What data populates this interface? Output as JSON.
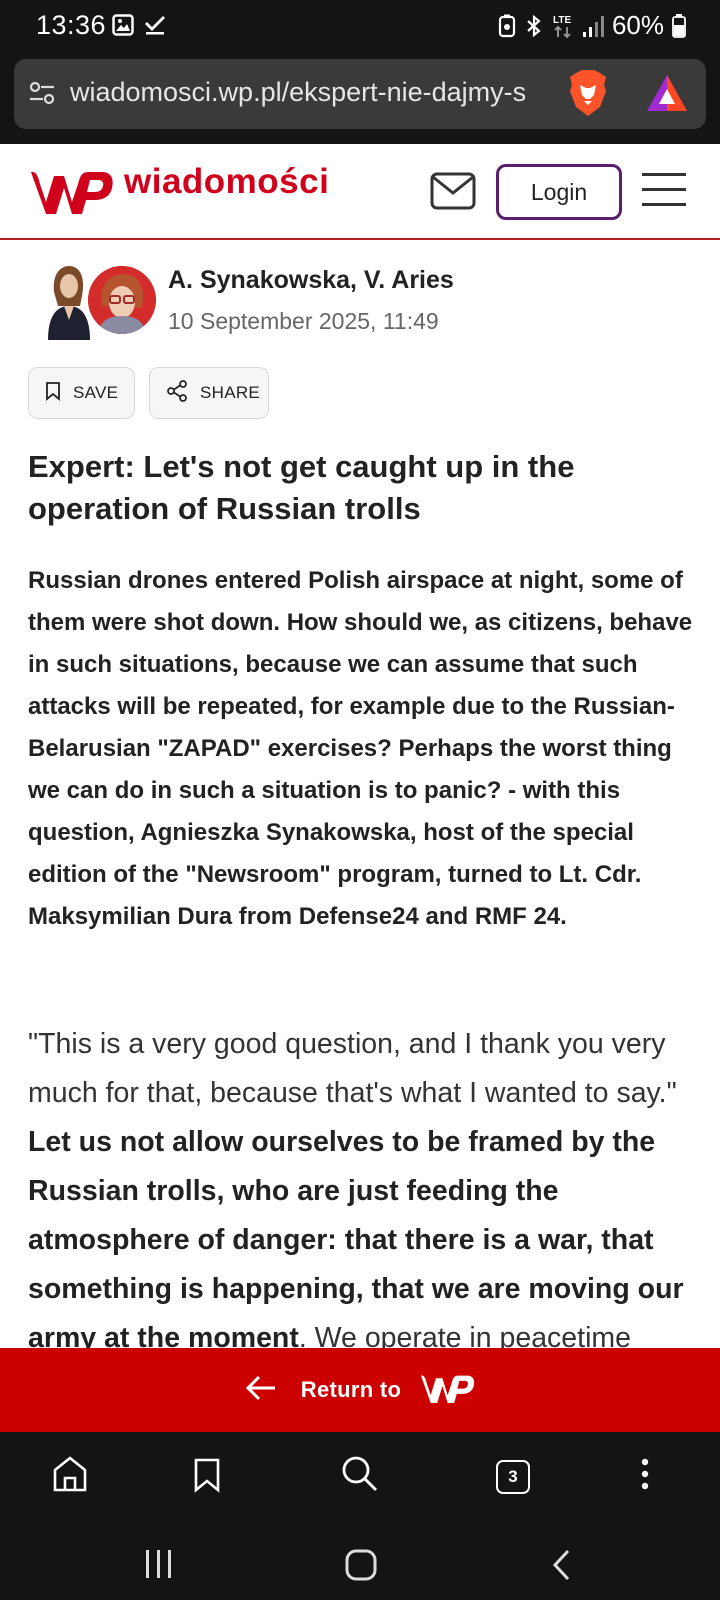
{
  "status_bar": {
    "time": "13:36",
    "network": "LTE",
    "battery": "60%",
    "icons": [
      "gallery-icon",
      "check-icon",
      "battery-saver-icon",
      "bluetooth-icon",
      "lte-icon",
      "signal-icon",
      "battery-icon"
    ]
  },
  "browser": {
    "url": "wiadomosci.wp.pl/ekspert-nie-dajmy-s",
    "tabs_count": "3"
  },
  "site": {
    "logo_text": "wiadomości",
    "login_label": "Login",
    "brand_color": "#d0021b"
  },
  "article": {
    "authors": "A. Synakowska, V. Aries",
    "date": "10 September 2025, 11:49",
    "save_label": "SAVE",
    "share_label": "SHARE",
    "title": "Expert: Let's not get caught up in the operation of Russian trolls",
    "lead": "Russian drones entered Polish airspace at night, some of them were shot down. How should we, as citizens, behave in such situations, because we can assume that such attacks will be repeated, for example due to the Russian-Belarusian \"ZAPAD\" exercises? Perhaps the worst thing we can do in such a situation is to panic? - with this question, Agnieszka Synakowska, host of the special edition of the \"Newsroom\" program, turned to Lt. Cdr. Maksymilian Dura from Defense24 and RMF 24.",
    "body_quote": "\"This is a very good question, and I thank you very much for that, because that's what I wanted to say.\" ",
    "body_bold": "Let us not allow ourselves to be framed by the Russian trolls, who are just feeding the atmosphere of danger: that there is a war, that something is happening, that we are moving our army at the moment",
    "body_tail": ". We operate in peacetime"
  },
  "return_bar": {
    "label": "Return to",
    "color": "#cc0000"
  }
}
